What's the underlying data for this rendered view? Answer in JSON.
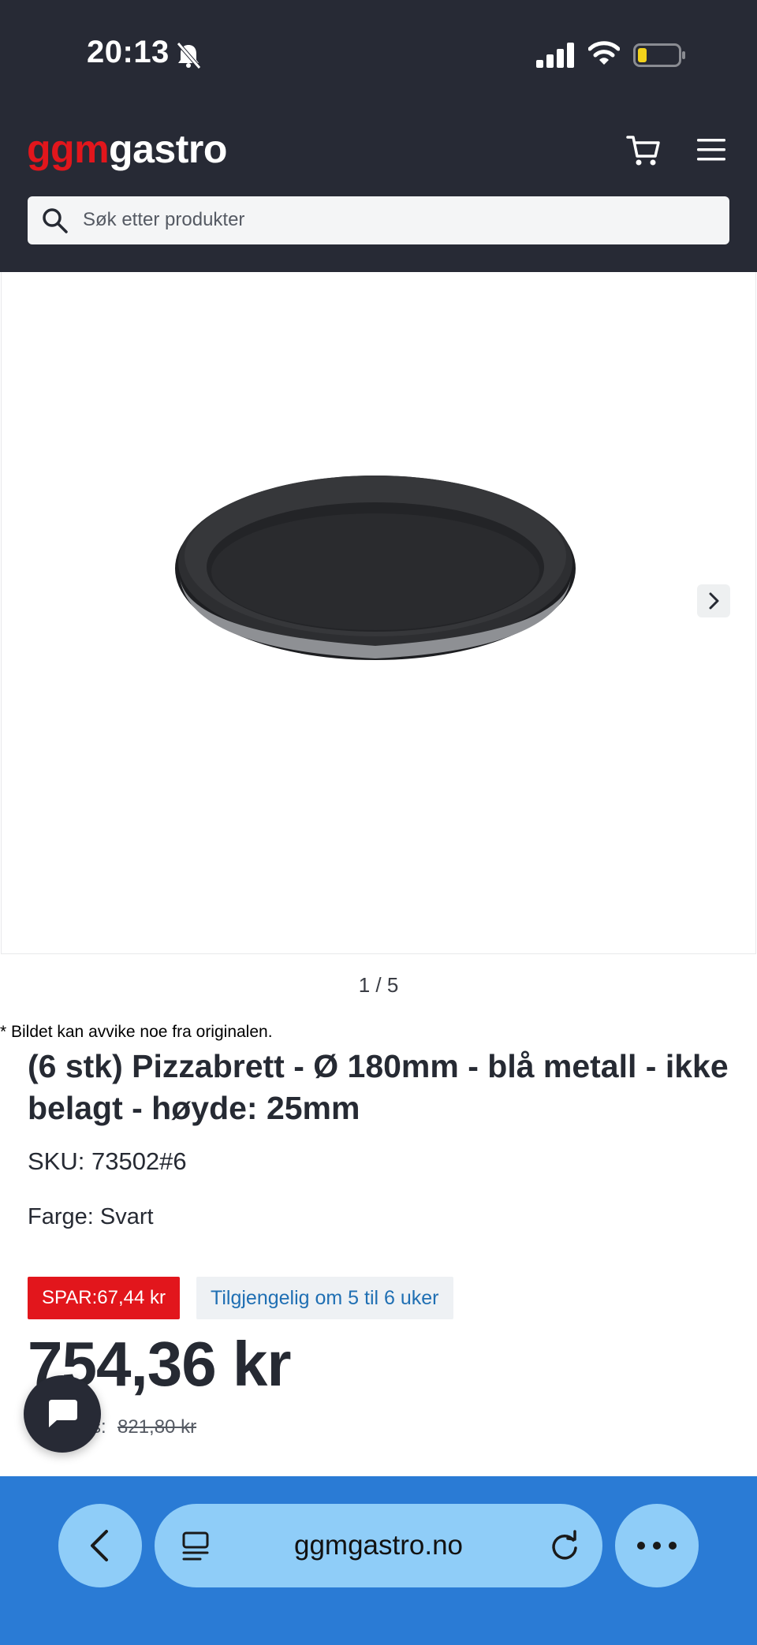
{
  "status": {
    "time": "20:13",
    "battery_color": "#f2d21b"
  },
  "header": {
    "logo_red": "ggm",
    "logo_white": "gastro",
    "brand_red": "#e2161c",
    "background": "#272a35"
  },
  "search": {
    "placeholder": "Søk etter produkter"
  },
  "gallery": {
    "counter": "1 / 5",
    "disclaimer": "* Bildet kan avvike noe fra originalen."
  },
  "product": {
    "title": "(6 stk) Pizzabrett - Ø 180mm - blå metall - ikke belagt - høyde: 25mm",
    "sku": "SKU: 73502#6",
    "color": "Farge: Svart",
    "spar": "SPAR:67,44 kr",
    "availability": "Tilgjengelig om 5 til 6 uker",
    "price": "754,36 kr",
    "old_prefix": "s:",
    "old_price": "821,80 kr"
  },
  "browser": {
    "url": "ggmgastro.no",
    "bar_color": "#2a7bd5"
  }
}
